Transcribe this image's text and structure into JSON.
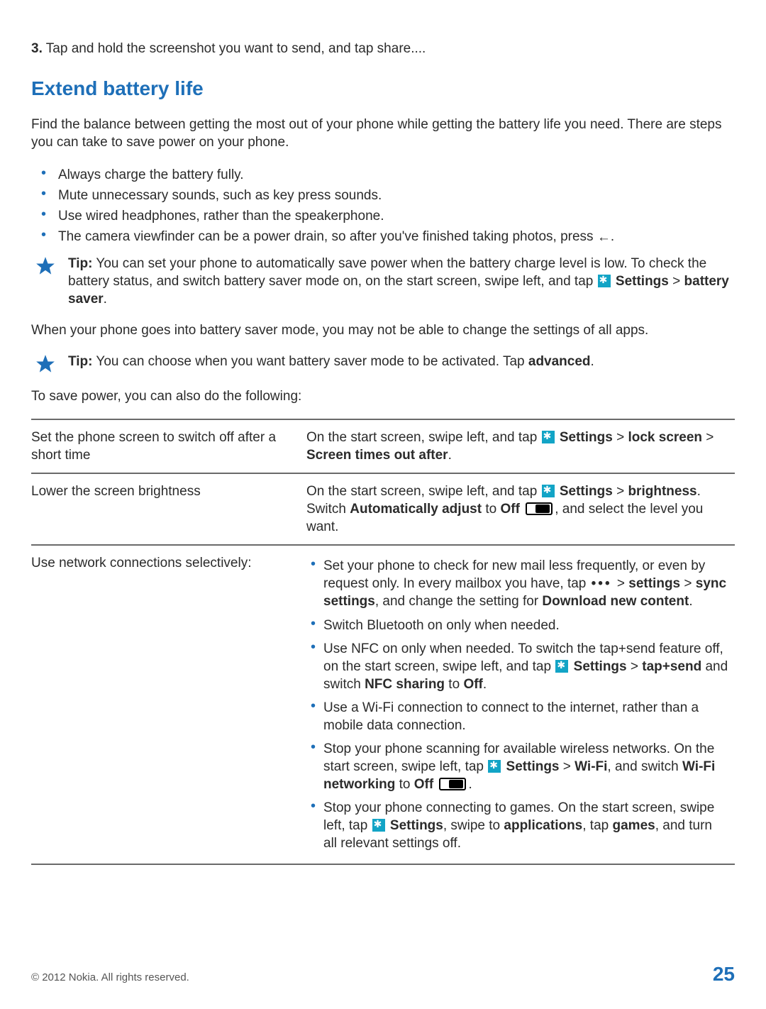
{
  "step3": {
    "num": "3.",
    "text": "Tap and hold the screenshot you want to send, and tap share...."
  },
  "section_heading": "Extend battery life",
  "intro": "Find the balance between getting the most out of your phone while getting the battery life you need. There are steps you can take to save power on your phone.",
  "main_bullets": [
    "Always charge the battery fully.",
    "Mute unnecessary sounds, such as key press sounds.",
    "Use wired headphones, rather than the speakerphone."
  ],
  "camera_bullet_pre": "The camera viewfinder can be a power drain, so after you've finished taking photos, press ",
  "camera_bullet_post": ".",
  "tip1": {
    "label": "Tip:",
    "t1": "You can set your phone to automatically save power when the battery charge level is low. To check the battery status, and switch battery saver mode on, on the start screen, swipe left, and tap ",
    "settings": "Settings",
    "sep": " > ",
    "bsaver": "battery saver",
    "end": "."
  },
  "saver_note": "When your phone goes into battery saver mode, you may not be able to change the settings of all apps.",
  "tip2": {
    "label": "Tip:",
    "t1": "You can choose when you want battery saver mode to be activated. Tap ",
    "adv": "advanced",
    "end": "."
  },
  "table_intro": "To save power, you can also do the following:",
  "row1": {
    "left": "Set the phone screen to switch off after a short time",
    "r_pre": "On the start screen, swipe left, and tap ",
    "settings": "Settings",
    "sep": " > ",
    "lock": "lock screen",
    "sep2": " > ",
    "timeout": "Screen times out after",
    "end": "."
  },
  "row2": {
    "left": "Lower the screen brightness",
    "r_pre": "On the start screen, swipe left, and tap ",
    "settings": "Settings",
    "sep": " > ",
    "bright": "brightness",
    "switch_pre": ". Switch ",
    "auto": "Automatically adjust",
    "to": " to ",
    "off": "Off",
    "tail": ", and select the level you want."
  },
  "row3": {
    "left": "Use network connections selectively:",
    "items": {
      "mail_pre": "Set your phone to check for new mail less frequently, or even by request only. In every mailbox you have, tap ",
      "mail_path1": "settings",
      "sep": " > ",
      "mail_path2": "sync settings",
      "mail_mid": ", and change the setting for ",
      "mail_dl": "Download new content",
      "end": ".",
      "bt": "Switch Bluetooth on only when needed.",
      "nfc_pre": "Use NFC on only when needed. To switch the tap+send feature off, on the start screen, swipe left, and tap ",
      "settings": "Settings",
      "nfc_path": "tap+send",
      "nfc_mid": " and switch ",
      "nfc_share": "NFC sharing",
      "to": " to ",
      "off": "Off",
      "wifi_text": "Use a Wi-Fi connection to connect to the internet, rather than a mobile data connection.",
      "scan_pre": "Stop your phone scanning for available wireless networks. On the start screen, swipe left, tap ",
      "scan_path": "Wi-Fi",
      "scan_mid": ", and switch ",
      "scan_net": "Wi-Fi networking",
      "games_pre": "Stop your phone connecting to games. On the start screen, swipe left, tap ",
      "games_mid": ", swipe to ",
      "apps": "applications",
      "games_tap": ", tap ",
      "games": "games",
      "games_tail": ", and turn all relevant settings off."
    }
  },
  "footer": {
    "copyright": "© 2012 Nokia. All rights reserved.",
    "page": "25"
  }
}
